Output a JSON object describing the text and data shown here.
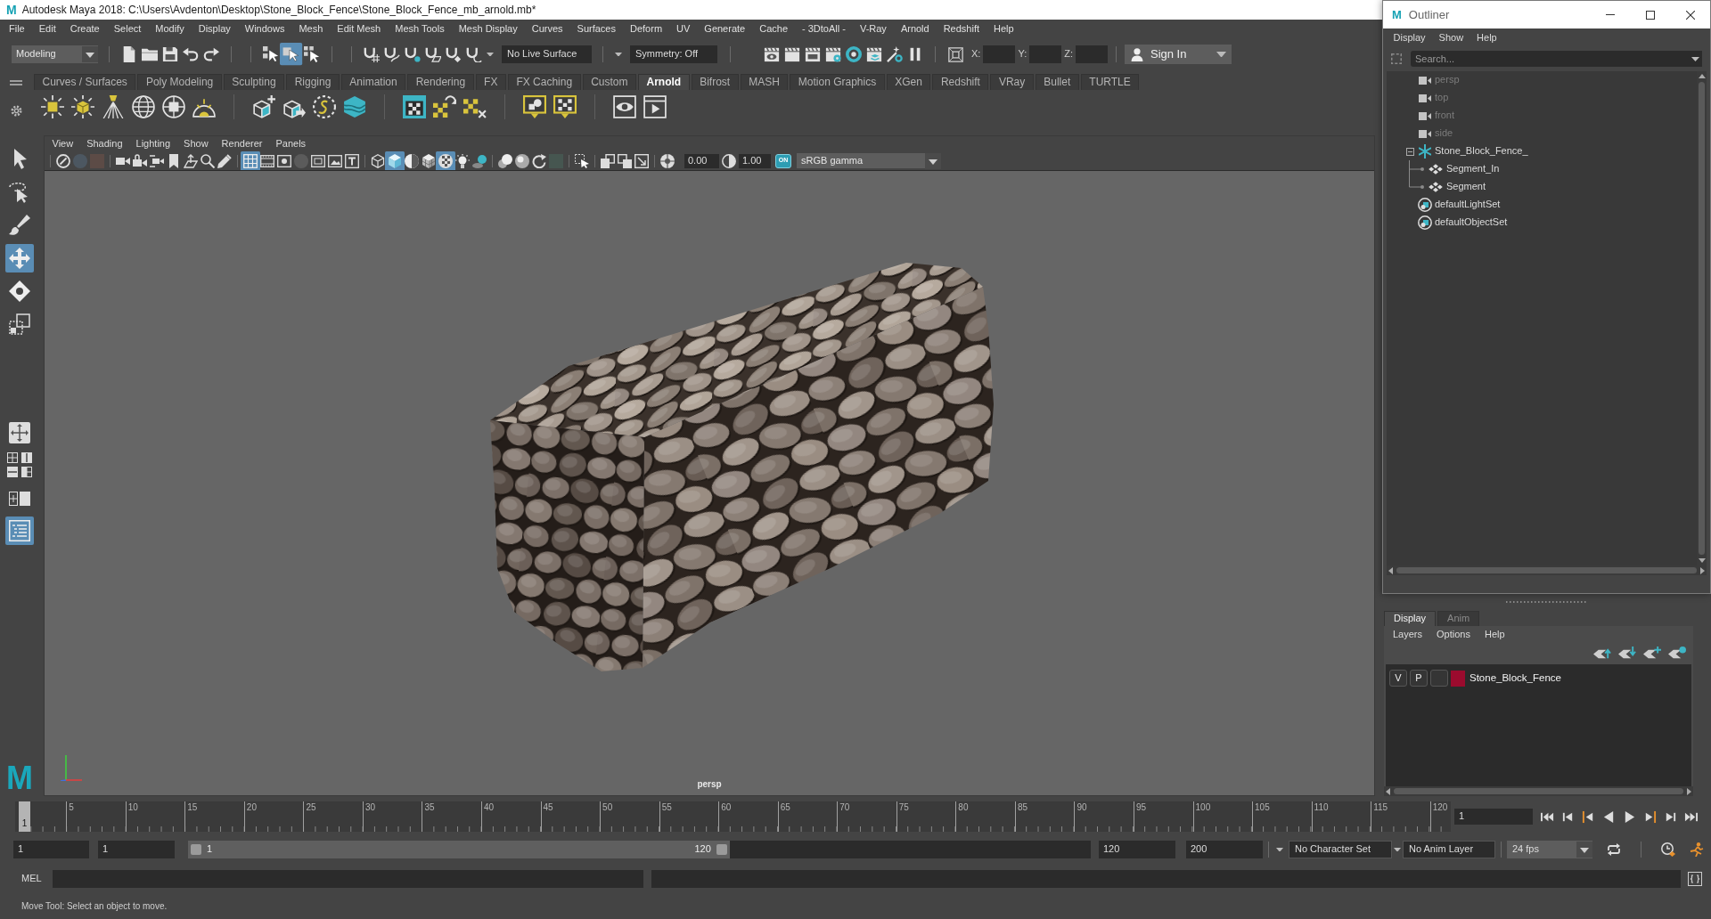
{
  "title_bar": {
    "logo": "M",
    "title": "Autodesk Maya 2018: C:\\Users\\Avdenton\\Desktop\\Stone_Block_Fence\\Stone_Block_Fence_mb_arnold.mb*"
  },
  "menu_bar": [
    "File",
    "Edit",
    "Create",
    "Select",
    "Modify",
    "Display",
    "Windows",
    "Mesh",
    "Edit Mesh",
    "Mesh Tools",
    "Mesh Display",
    "Curves",
    "Surfaces",
    "Deform",
    "UV",
    "Generate",
    "Cache",
    "- 3DtoAll -",
    "V-Ray",
    "Arnold",
    "Redshift",
    "Help"
  ],
  "status_line": {
    "mode": "Modeling",
    "select_tools": [
      {
        "on": false
      },
      {
        "on": true
      },
      {
        "on": false
      }
    ],
    "live_surface": "No Live Surface",
    "symmetry": "Symmetry: Off",
    "coordinates": [
      "X:",
      "Y:",
      "Z:"
    ],
    "sign_in": "Sign In"
  },
  "shelf": {
    "tabs": [
      {
        "label": "Curves / Surfaces",
        "selected": false
      },
      {
        "label": "Poly Modeling",
        "selected": false
      },
      {
        "label": "Sculpting",
        "selected": false
      },
      {
        "label": "Rigging",
        "selected": false
      },
      {
        "label": "Animation",
        "selected": false
      },
      {
        "label": "Rendering",
        "selected": false
      },
      {
        "label": "FX",
        "selected": false
      },
      {
        "label": "FX Caching",
        "selected": false
      },
      {
        "label": "Custom",
        "selected": false
      },
      {
        "label": "Arnold",
        "selected": true
      },
      {
        "label": "Bifrost",
        "selected": false
      },
      {
        "label": "MASH",
        "selected": false
      },
      {
        "label": "Motion Graphics",
        "selected": false
      },
      {
        "label": "XGen",
        "selected": false
      },
      {
        "label": "Redshift",
        "selected": false
      },
      {
        "label": "VRay",
        "selected": false
      },
      {
        "label": "Bullet",
        "selected": false
      },
      {
        "label": "TURTLE",
        "selected": false
      }
    ]
  },
  "toolbox": {
    "tools": [
      {
        "selected": false
      },
      {
        "selected": false
      },
      {
        "selected": false
      },
      {
        "selected": true
      },
      {
        "selected": false
      },
      {
        "selected": false
      }
    ],
    "layouts": [
      {
        "selected": false
      },
      {
        "selected": false
      },
      {
        "selected": false
      },
      {
        "selected": false
      },
      {
        "selected": false
      },
      {
        "selected": false
      },
      {
        "selected": true
      }
    ],
    "logo": "M"
  },
  "viewport": {
    "menu": [
      "View",
      "Shading",
      "Lighting",
      "Show",
      "Renderer",
      "Panels"
    ],
    "toolbar": [
      {
        "on": false,
        "disabled": false
      },
      {
        "on": false,
        "disabled": true
      },
      {
        "on": false,
        "disabled": true
      },
      {
        "on": false,
        "disabled": false
      },
      {
        "on": false,
        "disabled": false
      },
      {
        "on": false,
        "disabled": false
      },
      {
        "on": false,
        "disabled": false
      },
      {
        "on": false,
        "disabled": false
      },
      {
        "on": false,
        "disabled": false
      },
      {
        "on": false,
        "disabled": false
      },
      {
        "on": true,
        "disabled": false
      },
      {
        "on": false,
        "disabled": false
      },
      {
        "on": false,
        "disabled": false
      },
      {
        "on": false,
        "disabled": true
      },
      {
        "on": false,
        "disabled": false
      },
      {
        "on": false,
        "disabled": false
      },
      {
        "on": false,
        "disabled": false
      },
      {
        "on": false,
        "disabled": false
      },
      {
        "on": true,
        "disabled": false
      },
      {
        "on": false,
        "disabled": false
      },
      {
        "on": false,
        "disabled": false
      },
      {
        "on": true,
        "disabled": false
      },
      {
        "on": false,
        "disabled": false
      },
      {
        "on": false,
        "disabled": false
      },
      {
        "on": false,
        "disabled": false
      },
      {
        "on": false,
        "disabled": false
      },
      {
        "on": false,
        "disabled": false
      },
      {
        "on": false,
        "disabled": true
      },
      {
        "on": false,
        "disabled": false
      },
      {
        "on": false,
        "disabled": false
      },
      {
        "on": false,
        "disabled": false
      },
      {
        "on": false,
        "disabled": false
      },
      {
        "on": false,
        "disabled": false
      },
      {
        "on": false,
        "disabled": false
      }
    ],
    "exposure": "0.00",
    "gamma": "1.00",
    "color_management": {
      "label": "ON",
      "on": true
    },
    "view_transform": "sRGB gamma",
    "camera": "persp"
  },
  "outliner": {
    "logo": "M",
    "title": "Outliner",
    "menu": [
      "Display",
      "Show",
      "Help"
    ],
    "search": {
      "placeholder": "Search..."
    },
    "items": [
      {
        "label": "persp",
        "kind": "camera",
        "hidden": true
      },
      {
        "label": "top",
        "kind": "camera",
        "hidden": true
      },
      {
        "label": "front",
        "kind": "camera",
        "hidden": true
      },
      {
        "label": "side",
        "kind": "camera",
        "hidden": true
      },
      {
        "label": "Stone_Block_Fence_",
        "kind": "group",
        "hidden": false,
        "expanded": true,
        "children": [
          {
            "label": "Segment_In",
            "kind": "mesh",
            "hidden": false
          },
          {
            "label": "Segment",
            "kind": "mesh",
            "hidden": false
          }
        ]
      },
      {
        "label": "defaultLightSet",
        "kind": "set",
        "hidden": false
      },
      {
        "label": "defaultObjectSet",
        "kind": "set",
        "hidden": false
      }
    ]
  },
  "layer_editor": {
    "tabs": [
      {
        "label": "Display",
        "selected": true
      },
      {
        "label": "Anim",
        "selected": false
      }
    ],
    "menu": [
      "Layers",
      "Options",
      "Help"
    ],
    "layers": [
      {
        "visibility": "V",
        "playback": "P",
        "color": "#9b0b2e",
        "name": "Stone_Block_Fence"
      }
    ]
  },
  "time_slider": {
    "level": 0,
    "current_frame": "1",
    "tick_labels": [
      "5",
      "10",
      "15",
      "20",
      "25",
      "30",
      "35",
      "40",
      "45",
      "50",
      "55",
      "60",
      "65",
      "70",
      "75",
      "80",
      "85",
      "90",
      "95",
      "100",
      "105",
      "110",
      "115",
      "120"
    ],
    "frame_field": "1"
  },
  "range_slider": {
    "start": "1",
    "playback_start": "1",
    "range_start": "1",
    "range_end": "120",
    "level": 0.6,
    "playback_end": "120",
    "end": "200",
    "character_set": "No Character Set",
    "anim_layer": "No Anim Layer",
    "fps": "24 fps"
  },
  "command_line": {
    "language": "MEL"
  },
  "help_line": "Move Tool: Select an object to move."
}
